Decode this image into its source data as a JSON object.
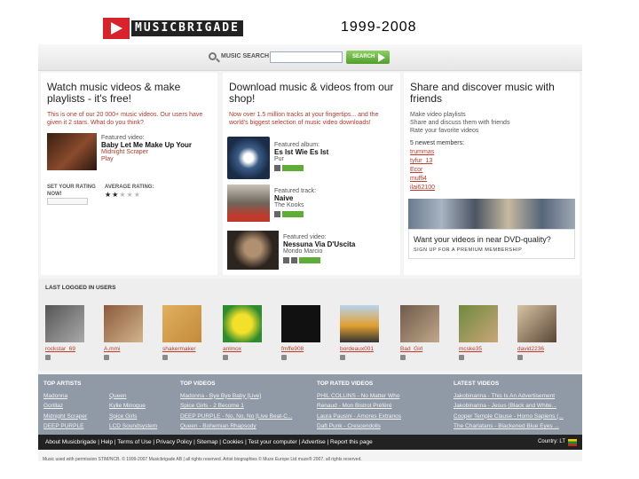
{
  "header": {
    "logo_text": "MUSICBRIGADE",
    "years": "1999-2008"
  },
  "search": {
    "label": "MUSIC SEARCH",
    "placeholder": "",
    "button_label": "SEARCH"
  },
  "videos": {
    "title": "Watch music videos & make playlists - it's free!",
    "subtitle": "This is one of our 20 000+ music videos. Our users have given it 2 stars. What do you think?",
    "featured_label": "Featured video:",
    "featured_title": "Baby Let Me Make Up Your",
    "featured_artist": "Midnight Scraper",
    "play_label": "Play",
    "set_rating_label": "SET YOUR RATING NOW!",
    "avg_rating_label": "AVERAGE RATING:",
    "average_rating": 2,
    "rating_max": 5
  },
  "shop": {
    "title": "Download music & videos from our shop!",
    "subtitle": "Now over 1.5 million tracks at your fingertips... and the world's biggest selection of music video downloads!",
    "album_label": "Featured album:",
    "album_title": "Es Ist Wie Es Ist",
    "album_artist": "Pur",
    "track_label": "Featured track:",
    "track_title": "Naive",
    "track_artist": "The Kooks",
    "video_label": "Featured video:",
    "video_title": "Nessuna Via D'Uscita",
    "video_artist": "Mondo Marcio"
  },
  "community": {
    "title": "Share and discover music with friends",
    "subtitle_lines": [
      "Make video playlists",
      "Share and discuss them with friends",
      "Rate your favorite videos"
    ],
    "newest_label": "5 newest members:",
    "newest_members": [
      "trummas",
      "tyfur_13",
      "Ecor",
      "muffi4",
      "ilai62100"
    ],
    "dvd_text": "Want your videos in near DVD-quality?",
    "dvd_sub": "SIGN UP FOR A PREMIUM MEMBERSHIP"
  },
  "last_logged": {
    "title": "LAST LOGGED IN USERS",
    "users": [
      "rockstar_69",
      "A.mmi",
      "shakermaker",
      "anlmox",
      "fmffe908",
      "bordeaux001",
      "Bad_Girl",
      "mcske35",
      "david2236"
    ]
  },
  "top_lists": {
    "artists": {
      "title": "TOP ARTISTS",
      "left": [
        "Madonna",
        "Gorillaz",
        "Midnight Scraper",
        "DEEP PURPLE"
      ],
      "right": [
        "Queen",
        "Kylie Minogue",
        "Spice Girls",
        "LCD Soundsystem"
      ]
    },
    "videos": {
      "title": "TOP VIDEOS",
      "rows": [
        "Madonna - Bye Bye Baby [Live]",
        "Spice Girls - 2 Become 1",
        "DEEP PURPLE - No, No, No [Live Beat-C...",
        "Queen - Bohemian Rhapsody"
      ]
    },
    "rated": {
      "title": "TOP RATED VIDEOS",
      "rows": [
        "PHIL COLLINS - No Matter Who",
        "Renaud - Mon Bistrot Préféré",
        "Laura Pausini - Amores Extranos",
        "Daft Punk - Crescendolls"
      ]
    },
    "latest": {
      "title": "LATEST VIDEOS",
      "rows": [
        "Jakobinarina - This Is An Advertisement",
        "Jakobinarina - Jesus (Black and White...",
        "Cooper Temple Clause - Homo Sapiens (...",
        "The Charlatans - Blackened Blue Eyes ..."
      ]
    }
  },
  "footer": {
    "links": "About Musicbrigade | Help | Terms of Use | Privacy Policy | Sitemap | Cookies | Test your computer | Advertise | Report this page",
    "country": "Country: LT"
  },
  "copyright": "Music used with permission STIM/NCB. © 1999-2007 Musicbrigade AB | all rights reserved. Artist biographies © Muze Europe Ltd muze® 2007. all rights reserved.",
  "colors": {
    "accent_red": "#c0392b",
    "search_green": "#5fad36",
    "toplist_bg": "#8f9aa6"
  }
}
